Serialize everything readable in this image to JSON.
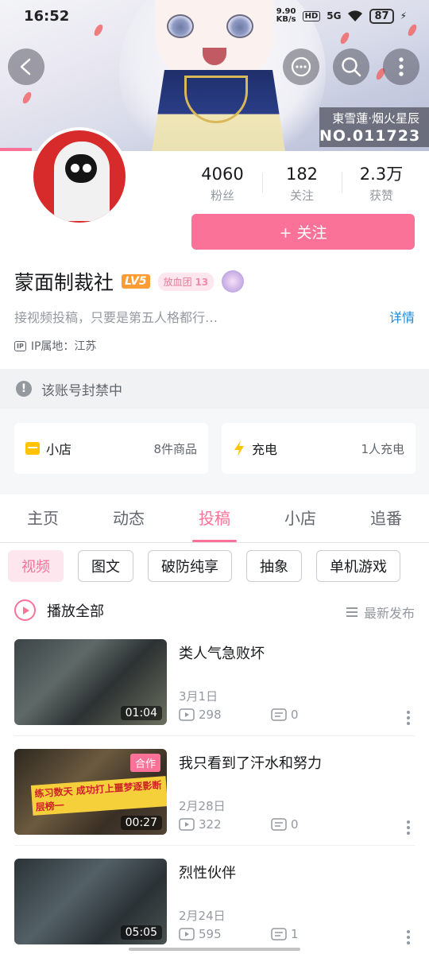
{
  "status_bar": {
    "time": "16:52",
    "net_speed_top": "9.90",
    "net_speed_unit": "KB/s",
    "hd": "HD",
    "signal": "5G",
    "battery": "87"
  },
  "banner": {
    "caption_line1": "東雪蓮·烟火星辰",
    "caption_line2": "NO.011723"
  },
  "profile": {
    "stats": [
      {
        "num": "4060",
        "label": "粉丝"
      },
      {
        "num": "182",
        "label": "关注"
      },
      {
        "num": "2.3万",
        "label": "获赞"
      }
    ],
    "follow_label": "+ 关注",
    "name": "蒙面制裁社",
    "level": "LV5",
    "fan_group": "放血团",
    "fan_level": "13",
    "bio": "接视频投稿，只要是第五人格都行…",
    "detail_link": "详情",
    "ip_badge": "IP",
    "ip_location": "IP属地：江苏"
  },
  "banned_notice": "该账号封禁中",
  "cards": {
    "shop": {
      "title": "小店",
      "meta": "8件商品"
    },
    "charge": {
      "title": "充电",
      "meta": "1人充电"
    }
  },
  "tabs": [
    "主页",
    "动态",
    "投稿",
    "小店",
    "追番"
  ],
  "active_tab": "投稿",
  "chips": [
    "视频",
    "图文",
    "破防纯享",
    "抽象",
    "单机游戏"
  ],
  "play_all": "播放全部",
  "sort_label": "最新发布",
  "videos": [
    {
      "title": "类人气急败坏",
      "date": "3月1日",
      "plays": "298",
      "comments": "0",
      "duration": "01:04"
    },
    {
      "title": "我只看到了汗水和努力",
      "date": "2月28日",
      "plays": "322",
      "comments": "0",
      "duration": "00:27",
      "tag": "合作",
      "thumb_text": "练习数天 成功打上噩梦逐影断层榜一"
    },
    {
      "title": "烈性伙伴",
      "date": "2月24日",
      "plays": "595",
      "comments": "1",
      "duration": "05:05"
    }
  ],
  "colors": {
    "accent": "#fb7299",
    "link": "#1e8ad6",
    "level": "#ff9c33"
  }
}
